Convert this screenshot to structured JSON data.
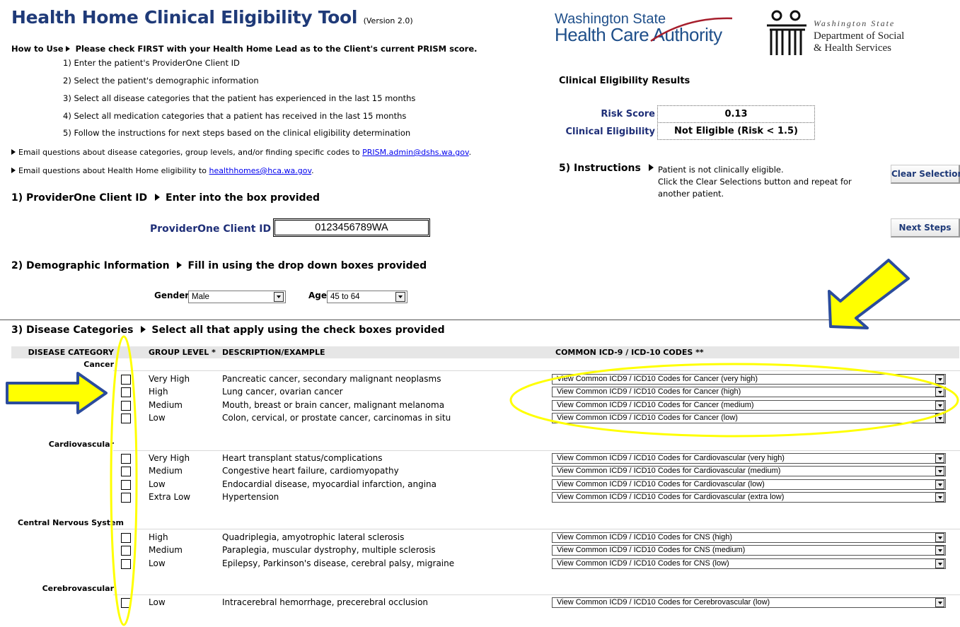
{
  "header": {
    "title": "Health Home Clinical Eligibility Tool",
    "version": "(Version 2.0)"
  },
  "how_to": {
    "label": "How to Use",
    "first": "Please check FIRST with your Health Home Lead as to the Client's current PRISM score.",
    "steps": [
      "1) Enter the patient's ProviderOne Client ID",
      "2) Select the patient's demographic information",
      "3) Select all disease categories that the patient has experienced in the last 15 months",
      "4) Select all medication categories that a patient has received in the last 15 months",
      "5) Follow the instructions for next steps based on the clinical eligibility determination"
    ],
    "email1_text": "Email questions about disease categories, group levels, and/or finding specific codes  to",
    "email1_link": "PRISM.admin@dshs.wa.gov",
    "email2_text": "Email questions about Health Home eligibility to",
    "email2_link": "healthhomes@hca.wa.gov",
    "period": "."
  },
  "logos": {
    "hca_line1": "Washington State",
    "hca_line2": "Health Care Authority",
    "dshs_line1": "Washington State",
    "dshs_line2": "Department of Social",
    "dshs_line3": "& Health Services"
  },
  "results": {
    "title": "Clinical Eligibility Results",
    "risk_label": "Risk Score",
    "risk_value": "0.13",
    "elig_label": "Clinical Eligibility",
    "elig_value": "Not Eligible (Risk < 1.5)"
  },
  "instructions": {
    "label": "5) Instructions",
    "line1": "Patient is not clinically eligible.",
    "line2": "Click the Clear Selections button and repeat for another patient."
  },
  "buttons": {
    "clear": "Clear Selections",
    "next": "Next Steps"
  },
  "section1": {
    "title": "1) ProviderOne Client ID",
    "sub": "Enter into the box provided",
    "field_label": "ProviderOne Client ID",
    "field_value": "0123456789WA"
  },
  "section2": {
    "title": "2) Demographic Information",
    "sub": "Fill in using the drop down boxes provided",
    "gender_label": "Gender",
    "gender_value": "Male",
    "age_label": "Age",
    "age_value": "45 to 64"
  },
  "section3": {
    "title": "3) Disease Categories",
    "sub": "Select all that apply using the check boxes provided",
    "headers": {
      "category": "DISEASE CATEGORY",
      "level": "GROUP LEVEL *",
      "desc": "DESCRIPTION/EXAMPLE",
      "codes": "COMMON ICD-9 / ICD-10 CODES **"
    },
    "categories": [
      {
        "name": "Cancer",
        "rows": [
          {
            "level": "Very High",
            "desc": "Pancreatic cancer, secondary malignant neoplasms",
            "code": "View Common ICD9 / ICD10 Codes for Cancer (very high)"
          },
          {
            "level": "High",
            "desc": "Lung cancer, ovarian cancer",
            "code": "View Common ICD9 / ICD10 Codes for Cancer (high)"
          },
          {
            "level": "Medium",
            "desc": "Mouth, breast or brain cancer, malignant melanoma",
            "code": "View Common ICD9 / ICD10 Codes for Cancer (medium)"
          },
          {
            "level": "Low",
            "desc": "Colon, cervical, or prostate cancer, carcinomas in situ",
            "code": "View Common ICD9 / ICD10 Codes for Cancer (low)"
          }
        ]
      },
      {
        "name": "Cardiovascular",
        "rows": [
          {
            "level": "Very High",
            "desc": "Heart transplant status/complications",
            "code": "View Common ICD9 / ICD10 Codes for Cardiovascular (very high)"
          },
          {
            "level": "Medium",
            "desc": "Congestive heart failure, cardiomyopathy",
            "code": "View Common ICD9 / ICD10 Codes for Cardiovascular (medium)"
          },
          {
            "level": "Low",
            "desc": "Endocardial disease, myocardial infarction, angina",
            "code": "View Common ICD9 / ICD10 Codes for Cardiovascular (low)"
          },
          {
            "level": "Extra Low",
            "desc": "Hypertension",
            "code": "View Common ICD9 / ICD10 Codes for Cardiovascular (extra low)"
          }
        ]
      },
      {
        "name": "Central Nervous System",
        "rows": [
          {
            "level": "High",
            "desc": "Quadriplegia, amyotrophic lateral sclerosis",
            "code": "View Common ICD9 / ICD10 Codes for CNS (high)"
          },
          {
            "level": "Medium",
            "desc": "Paraplegia, muscular dystrophy, multiple sclerosis",
            "code": "View Common ICD9 / ICD10 Codes for CNS (medium)"
          },
          {
            "level": "Low",
            "desc": "Epilepsy, Parkinson's disease, cerebral palsy, migraine",
            "code": "View Common ICD9 / ICD10 Codes for CNS (low)"
          }
        ]
      },
      {
        "name": "Cerebrovascular",
        "rows": [
          {
            "level": "Low",
            "desc": "Intracerebral hemorrhage, precerebral occlusion",
            "code": "View Common ICD9 / ICD10 Codes for Cerebrovascular (low)"
          }
        ]
      }
    ]
  },
  "colors": {
    "title_blue": "#1f3a78",
    "highlight_yellow": "#ffff00",
    "arrow_blue": "#2b4c9c"
  }
}
